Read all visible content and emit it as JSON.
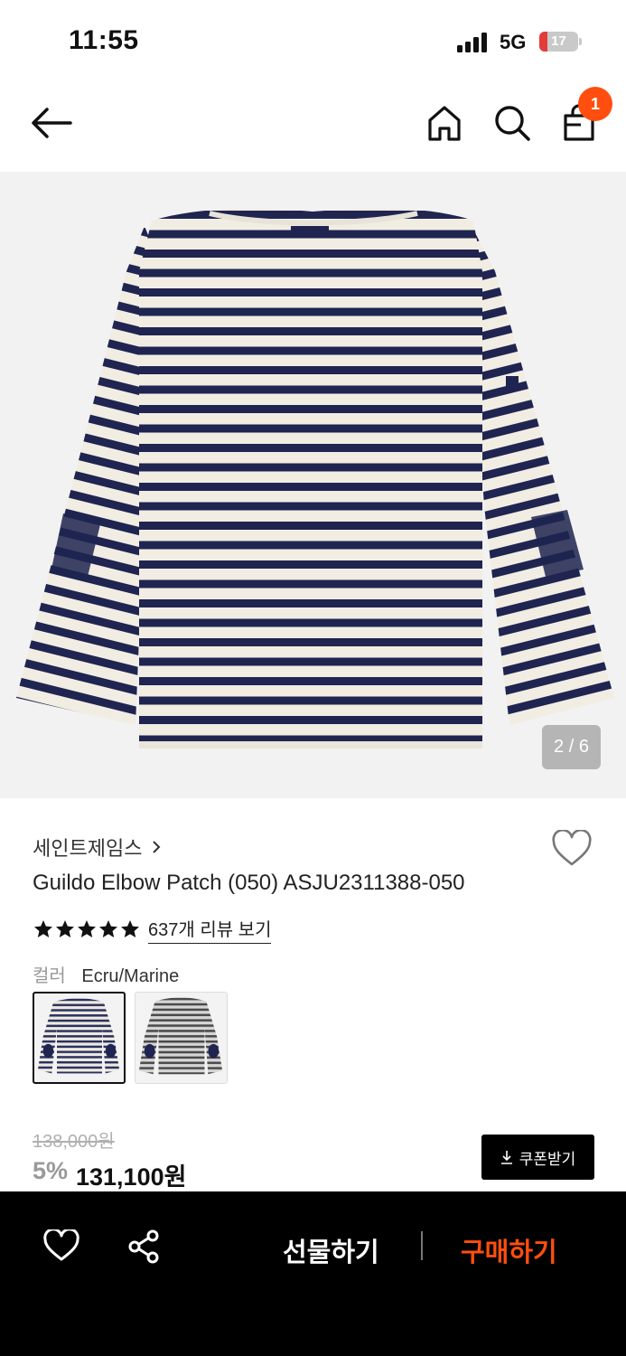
{
  "status_bar": {
    "time": "11:55",
    "network": "5G",
    "battery": "17"
  },
  "header": {
    "cart_count": "1"
  },
  "gallery": {
    "counter": "2 / 6"
  },
  "product": {
    "brand": "세인트제임스",
    "name": "Guildo Elbow Patch (050) ASJU2311388-050",
    "rating_stars": 5,
    "review_link": "637개 리뷰 보기",
    "color_label": "컬러",
    "color_value": "Ecru/Marine"
  },
  "price": {
    "original": "138,000원",
    "discount": "5%",
    "sale": "131,100원",
    "coupon_label": "쿠폰받기"
  },
  "bottom_bar": {
    "gift_label": "선물하기",
    "buy_label": "구매하기"
  },
  "colors": {
    "accent": "#ff4e0f",
    "navy_stripe": "#1f2550",
    "ecru": "#f1ede3"
  },
  "icons": [
    "back-arrow-icon",
    "home-icon",
    "search-icon",
    "shopping-bag-icon",
    "heart-icon",
    "chevron-right-icon",
    "star-icon",
    "download-icon",
    "share-icon"
  ]
}
